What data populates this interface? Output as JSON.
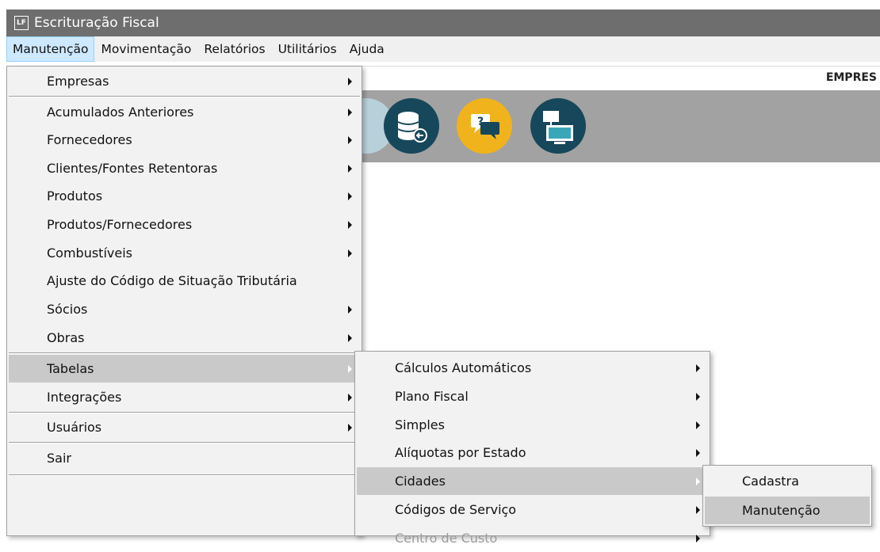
{
  "titlebar": {
    "icon_text": "LF",
    "title": "Escrituração Fiscal"
  },
  "menubar": {
    "items": [
      "Manutenção",
      "Movimentação",
      "Relatórios",
      "Utilitários",
      "Ajuda"
    ]
  },
  "header": {
    "empresa_label": "EMPRES"
  },
  "toolbar": {
    "icons": [
      "database-icon",
      "help-chat-icon",
      "network-computers-icon"
    ]
  },
  "menu_main": {
    "items": [
      {
        "label": "Empresas",
        "submenu": true
      },
      {
        "label": "Acumulados Anteriores",
        "submenu": true
      },
      {
        "label": "Fornecedores",
        "submenu": true
      },
      {
        "label": "Clientes/Fontes Retentoras",
        "submenu": true
      },
      {
        "label": "Produtos",
        "submenu": true
      },
      {
        "label": "Produtos/Fornecedores",
        "submenu": true
      },
      {
        "label": "Combustíveis",
        "submenu": true
      },
      {
        "label": "Ajuste do Código de Situação Tributária",
        "submenu": false
      },
      {
        "label": "Sócios",
        "submenu": true
      },
      {
        "label": "Obras",
        "submenu": true
      },
      {
        "label": "Tabelas",
        "submenu": true,
        "highlighted": true
      },
      {
        "label": "Integrações",
        "submenu": true
      },
      {
        "label": "Usuários",
        "submenu": true
      },
      {
        "label": "Sair",
        "submenu": false
      }
    ]
  },
  "menu_tabelas": {
    "items": [
      {
        "label": "Cálculos Automáticos",
        "submenu": true
      },
      {
        "label": "Plano Fiscal",
        "submenu": true
      },
      {
        "label": "Simples",
        "submenu": true
      },
      {
        "label": "Alíquotas por Estado",
        "submenu": true
      },
      {
        "label": "Cidades",
        "submenu": true,
        "highlighted": true
      },
      {
        "label": "Códigos de Serviço",
        "submenu": true
      },
      {
        "label": "Centro de Custo",
        "submenu": true
      }
    ]
  },
  "menu_cidades": {
    "items": [
      {
        "label": "Cadastra"
      },
      {
        "label": "Manutenção",
        "highlighted": true
      }
    ]
  },
  "colors": {
    "titlebar": "#6e6e6e",
    "menu_bg": "#f2f2f2",
    "highlight": "#c9c9c9",
    "toolbar_band": "#a2a2a2",
    "icon_teal": "#17475a",
    "icon_yellow": "#f1b31c"
  }
}
